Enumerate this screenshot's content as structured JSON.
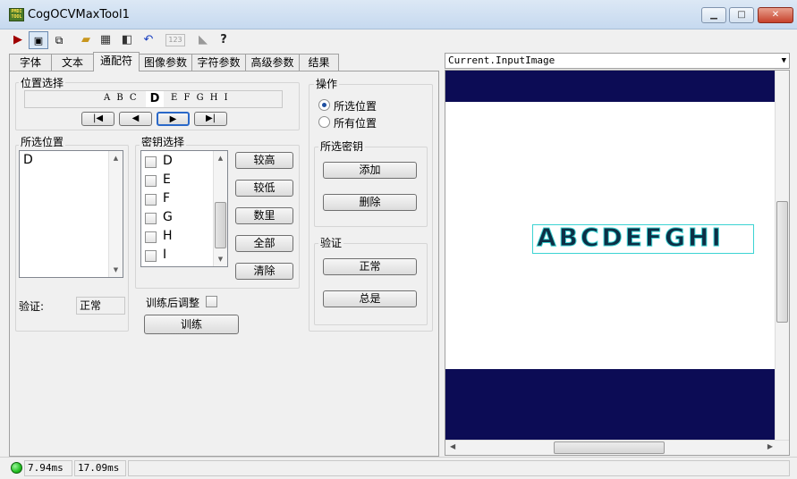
{
  "window": {
    "title": "CogOCVMaxTool1",
    "icon_text": "PMDI TOOL"
  },
  "toolbar": {
    "items": [
      {
        "name": "run-icon",
        "glyph": "▶"
      },
      {
        "name": "image-view-icon",
        "glyph": "▣"
      },
      {
        "name": "copy-icon",
        "glyph": "⧉"
      },
      {
        "name": "open-folder-icon",
        "glyph": "📂"
      },
      {
        "name": "save-icon",
        "glyph": "💾"
      },
      {
        "name": "settings-icon",
        "glyph": "⚙"
      },
      {
        "name": "reset-icon",
        "glyph": "↶"
      },
      {
        "name": "numeric-icon",
        "glyph": "123"
      },
      {
        "name": "graphics-icon",
        "glyph": "◣"
      },
      {
        "name": "help-icon",
        "glyph": "?"
      }
    ]
  },
  "tabs": [
    "字体",
    "文本",
    "通配符",
    "图像参数",
    "字符参数",
    "高级参数",
    "结果"
  ],
  "position_select": {
    "label": "位置选择",
    "text_before": "A B C",
    "current_char": "D",
    "text_after": "E F G H I"
  },
  "selected_positions": {
    "label": "所选位置",
    "items": [
      "D"
    ]
  },
  "key_select": {
    "label": "密钥选择",
    "items": [
      "D",
      "E",
      "F",
      "G",
      "H",
      "I"
    ],
    "buttons": [
      "较高",
      "较低",
      "数里",
      "全部",
      "清除"
    ]
  },
  "verify_row": {
    "label": "验证:",
    "value": "正常"
  },
  "train": {
    "adjust_label": "训练后调整",
    "button": "训练"
  },
  "operation": {
    "label": "操作",
    "radios": [
      {
        "label": "所选位置",
        "checked": true
      },
      {
        "label": "所有位置",
        "checked": false
      }
    ]
  },
  "selected_key": {
    "label": "所选密钥",
    "buttons": [
      "添加",
      "删除"
    ]
  },
  "verify_group": {
    "label": "验证",
    "buttons": [
      "正常",
      "总是"
    ]
  },
  "image": {
    "source": "Current.InputImage",
    "ocr_text": "ABCDEFGHI"
  },
  "status": {
    "time1": "7.94ms",
    "time2": "17.09ms",
    "led_color": "#22c022"
  },
  "colors": {
    "image_dark": "#0c0c55",
    "roi_box": "#3bd3d3",
    "text_fill": "#0d2f46"
  }
}
